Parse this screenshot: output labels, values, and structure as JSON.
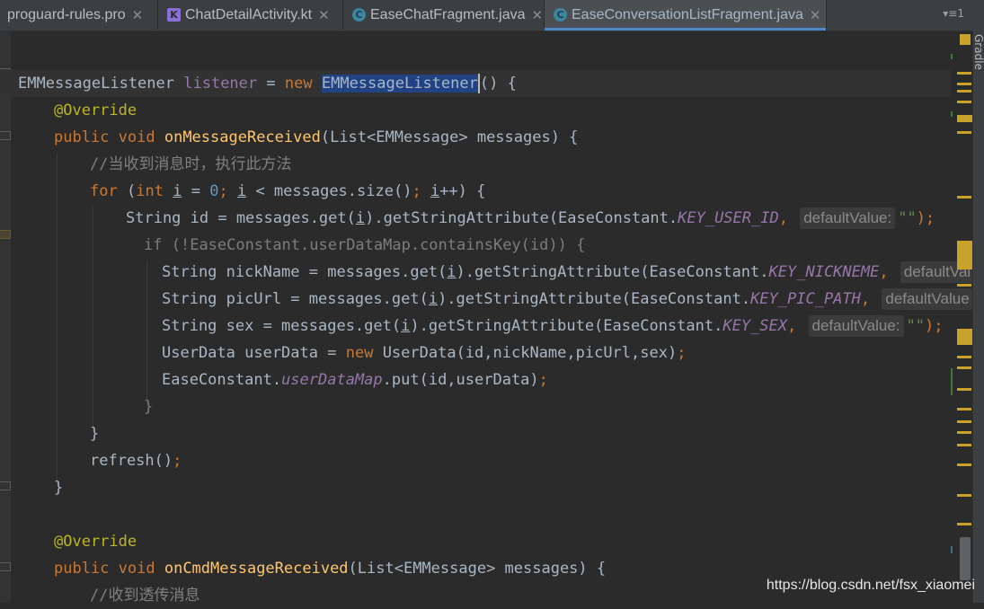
{
  "tabs": [
    {
      "label": "proguard-rules.pro",
      "icon": "file-icon",
      "active": false
    },
    {
      "label": "ChatDetailActivity.kt",
      "icon": "kotlin-icon",
      "active": false
    },
    {
      "label": "EaseChatFragment.java",
      "icon": "class-icon",
      "active": false
    },
    {
      "label": "EaseConversationListFragment.java",
      "icon": "class-icon",
      "active": true
    }
  ],
  "tab_overflow": "▾≡1",
  "side_panel": {
    "label": "Gradle"
  },
  "code": {
    "l1": {
      "type1": "EMMessageListener",
      "var": "listener",
      "eq": "=",
      "kw_new": "new",
      "type2": "EMMessageListener",
      "rest": "() {"
    },
    "l2": {
      "ann": "@Override"
    },
    "l3": {
      "kw": "public void",
      "fn": "onMessageReceived",
      "rest": "(List<EMMessage> messages) {"
    },
    "l4": {
      "comment": "//当收到消息时，执行此方法"
    },
    "l5": {
      "kw_for": "for",
      "p1": "(",
      "kw_int": "int",
      "i": "i",
      "eq0": "=",
      "zero": "0",
      "semi1": ";",
      "i2": "i",
      "cond": "< messages.size()",
      "semi2": ";",
      "i3": "i",
      "inc": "++) {"
    },
    "l6": {
      "pre": "String id = messages.get(",
      "i": "i",
      "mid": ").getStringAttribute(EaseConstant.",
      "konst": "KEY_USER_ID",
      "comma": ",",
      "hint": "defaultValue:",
      "str": "\"\"",
      "end": ");"
    },
    "l7": {
      "kw_if": "if",
      "rest": "(!EaseConstant.userDataMap.containsKey(id)) {"
    },
    "l8": {
      "pre": "String nickName = messages.get(",
      "i": "i",
      "mid": ").getStringAttribute(EaseConstant.",
      "konst": "KEY_NICKNEME",
      "comma": ",",
      "hint": "defaultVal"
    },
    "l9": {
      "pre": "String picUrl = messages.get(",
      "i": "i",
      "mid": ").getStringAttribute(EaseConstant.",
      "konst": "KEY_PIC_PATH",
      "comma": ",",
      "hint": "defaultValue"
    },
    "l10": {
      "pre": "String sex = messages.get(",
      "i": "i",
      "mid": ").getStringAttribute(EaseConstant.",
      "konst": "KEY_SEX",
      "comma": ",",
      "hint": "defaultValue:",
      "str": "\"\"",
      "end": ");"
    },
    "l11": {
      "pre": "UserData userData =",
      "kw_new": "new",
      "rest": "UserData(id,nickName,picUrl,sex)",
      "semi": ";"
    },
    "l12": {
      "pre": "EaseConstant.",
      "field": "userDataMap",
      "rest": ".put(id,userData)",
      "semi": ";"
    },
    "l13": {
      "brace": "}"
    },
    "l14": {
      "brace": "}"
    },
    "l15": {
      "call": "refresh()",
      "semi": ";"
    },
    "l16": {
      "brace": "}"
    },
    "l18": {
      "ann": "@Override"
    },
    "l19": {
      "kw": "public void",
      "fn": "onCmdMessageReceived",
      "rest": "(List<EMMessage> messages) {"
    },
    "l20": {
      "comment": "//收到透传消息"
    }
  },
  "watermark": "https://blog.csdn.net/fsx_xiaomei",
  "colors": {
    "keyword": "#cc7832",
    "annotation": "#bbb529",
    "function": "#ffc66d",
    "comment": "#808080",
    "constant": "#9876aa",
    "background": "#2b2b2b"
  }
}
